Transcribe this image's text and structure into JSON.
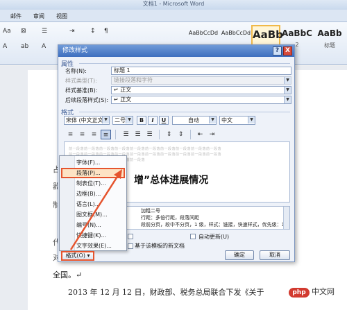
{
  "window": {
    "title": "文档1 - Microsoft Word"
  },
  "tabs": [
    "邮件",
    "审阅",
    "视图"
  ],
  "ribbon": {
    "font_size_label": "Aa",
    "styles": [
      {
        "preview": "AaBbCcDd",
        "label": ""
      },
      {
        "preview": "AaBbCcDd",
        "label": ""
      },
      {
        "preview": "AaBb",
        "label": ""
      },
      {
        "preview": "AaBbC",
        "label": "2"
      },
      {
        "preview": "AaBb",
        "label": "标题"
      }
    ]
  },
  "document": {
    "lines": [
      "全国。↵",
      "2013 年 12 月 12 日，财政部、税务总局联合下发《关于"
    ],
    "left_chars": [
      "占",
      "器",
      "制",
      "代",
      "对"
    ],
    "watermark": "中文网",
    "watermark_logo": "php"
  },
  "dialog": {
    "title": "修改样式",
    "help": "?",
    "close": "X",
    "section_properties": "属性",
    "name_label": "名称(N):",
    "name_value": "标题 1",
    "type_label": "样式类型(T):",
    "type_value": "链接段落和字符",
    "based_label": "样式基准(B):",
    "based_value": "↵ 正文",
    "next_label": "后续段落样式(S):",
    "next_value": "↵ 正文",
    "section_format": "格式",
    "font_value": "宋体 (中文正文)",
    "size_value": "二号",
    "bold": "B",
    "italic": "I",
    "underline": "U",
    "color_value": "自动",
    "lang_value": "中文",
    "preview_lines": [
      "前一段落前一段落前一段落前一段落前一段落前一段落前一段落前一段落前一段落前一段落",
      "前一段落前一段落前一段落前一段落前一段落前一段落前一段落前一段落前一段落前一段落",
      "前一段落前一段落前一段落前一段落前一段落"
    ],
    "preview_sample": "增”总体进展情况",
    "desc_lines": [
      "加粗二号",
      "行距：多倍行距，段落间距",
      "段前分页，段中不分页，1 级，样式：链接，快速样式，优先级：10"
    ],
    "auto_update": "自动更新(U)",
    "template_option": "基于该模板的新文档",
    "ok": "确定",
    "cancel": "取消"
  },
  "format_menu": {
    "button": "格式(O) ▾",
    "items": [
      "字体(F)...",
      "段落(P)...",
      "制表位(T)...",
      "边框(B)...",
      "语言(L)...",
      "图文框(M)...",
      "编号(N)...",
      "快捷键(K)...",
      "文字效果(E)..."
    ],
    "highlighted_index": 1
  },
  "colors": {
    "highlight": "#e5542e",
    "title_bar": "#3e6fbf"
  }
}
